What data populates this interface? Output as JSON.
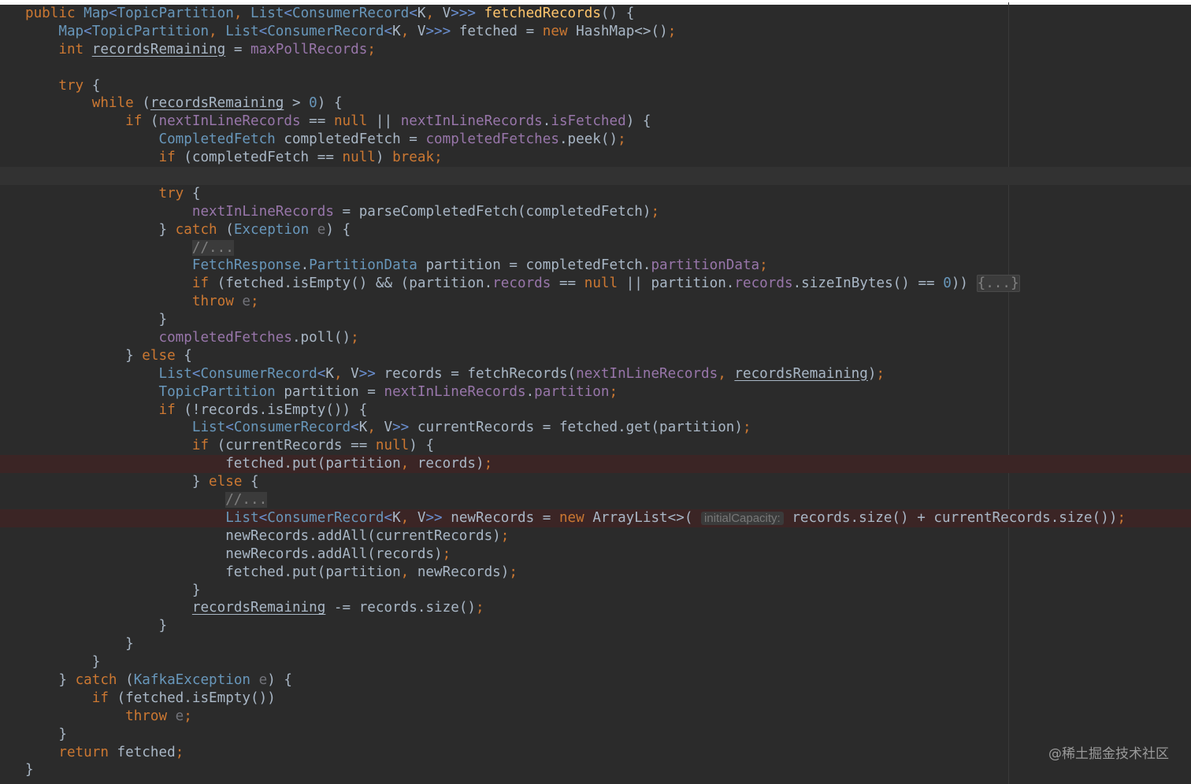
{
  "watermark": "@稀土掘金技术社区",
  "colors": {
    "background": "#2b2b2b",
    "keyword": "#cc7832",
    "field": "#9876aa",
    "method": "#ffc66d",
    "number": "#6897bb",
    "comment": "#808080",
    "text": "#a9b7c6"
  },
  "code_lines": [
    [
      [
        "kw",
        "public "
      ],
      [
        "typ",
        "Map"
      ],
      [
        "tag",
        "<"
      ],
      [
        "typ",
        "TopicPartition"
      ],
      [
        "punc",
        ", "
      ],
      [
        "typ",
        "List"
      ],
      [
        "tag",
        "<"
      ],
      [
        "typ",
        "ConsumerRecord"
      ],
      [
        "tag",
        "<"
      ],
      [
        "var",
        "K"
      ],
      [
        "punc",
        ", "
      ],
      [
        "var",
        "V"
      ],
      [
        "tag",
        ">>> "
      ],
      [
        "meth",
        "fetchedRecords"
      ],
      [
        "var",
        "() {"
      ]
    ],
    [
      [
        "var",
        "    "
      ],
      [
        "typ",
        "Map"
      ],
      [
        "tag",
        "<"
      ],
      [
        "typ",
        "TopicPartition"
      ],
      [
        "punc",
        ", "
      ],
      [
        "typ",
        "List"
      ],
      [
        "tag",
        "<"
      ],
      [
        "typ",
        "ConsumerRecord"
      ],
      [
        "tag",
        "<"
      ],
      [
        "var",
        "K"
      ],
      [
        "punc",
        ", "
      ],
      [
        "var",
        "V"
      ],
      [
        "tag",
        ">>> "
      ],
      [
        "var",
        "fetched = "
      ],
      [
        "kw",
        "new "
      ],
      [
        "var",
        "HashMap<>()"
      ],
      [
        "punc",
        ";"
      ]
    ],
    [
      [
        "var",
        "    "
      ],
      [
        "kw",
        "int "
      ],
      [
        "und",
        "recordsRemaining"
      ],
      [
        "var",
        " = "
      ],
      [
        "fld",
        "maxPollRecords"
      ],
      [
        "punc",
        ";"
      ]
    ],
    [
      [
        "var",
        ""
      ]
    ],
    [
      [
        "var",
        "    "
      ],
      [
        "kw",
        "try "
      ],
      [
        "var",
        "{"
      ]
    ],
    [
      [
        "var",
        "        "
      ],
      [
        "kw",
        "while "
      ],
      [
        "var",
        "("
      ],
      [
        "und",
        "recordsRemaining"
      ],
      [
        "var",
        " > "
      ],
      [
        "num",
        "0"
      ],
      [
        "var",
        ") {"
      ]
    ],
    [
      [
        "var",
        "            "
      ],
      [
        "kw",
        "if "
      ],
      [
        "var",
        "("
      ],
      [
        "fld",
        "nextInLineRecords"
      ],
      [
        "var",
        " == "
      ],
      [
        "kw",
        "null"
      ],
      [
        "var",
        " || "
      ],
      [
        "fld",
        "nextInLineRecords"
      ],
      [
        "var",
        "."
      ],
      [
        "fld",
        "isFetched"
      ],
      [
        "var",
        ") {"
      ]
    ],
    [
      [
        "var",
        "                "
      ],
      [
        "typ",
        "CompletedFetch "
      ],
      [
        "var",
        "completedFetch = "
      ],
      [
        "fld",
        "completedFetches"
      ],
      [
        "var",
        ".peek()"
      ],
      [
        "punc",
        ";"
      ]
    ],
    [
      [
        "var",
        "                "
      ],
      [
        "kw",
        "if "
      ],
      [
        "var",
        "(completedFetch == "
      ],
      [
        "kw",
        "null"
      ],
      [
        "var",
        ") "
      ],
      [
        "kw",
        "break"
      ],
      [
        "punc",
        ";"
      ]
    ],
    [
      [
        "var",
        ""
      ]
    ],
    [
      [
        "var",
        "                "
      ],
      [
        "kw",
        "try "
      ],
      [
        "var",
        "{"
      ]
    ],
    [
      [
        "var",
        "                    "
      ],
      [
        "fld",
        "nextInLineRecords"
      ],
      [
        "var",
        " = parseCompletedFetch(completedFetch)"
      ],
      [
        "punc",
        ";"
      ]
    ],
    [
      [
        "var",
        "                } "
      ],
      [
        "kw",
        "catch "
      ],
      [
        "var",
        "("
      ],
      [
        "typ",
        "Exception "
      ],
      [
        "param",
        "e"
      ],
      [
        "var",
        ") {"
      ]
    ],
    [
      [
        "var",
        "                    "
      ],
      [
        "cmt",
        "//..."
      ]
    ],
    [
      [
        "var",
        "                    "
      ],
      [
        "typ",
        "FetchResponse"
      ],
      [
        "var",
        "."
      ],
      [
        "typ",
        "PartitionData "
      ],
      [
        "var",
        "partition = completedFetch."
      ],
      [
        "fld",
        "partitionData"
      ],
      [
        "punc",
        ";"
      ]
    ],
    [
      [
        "var",
        "                    "
      ],
      [
        "kw",
        "if "
      ],
      [
        "var",
        "(fetched.isEmpty() && (partition."
      ],
      [
        "fld",
        "records"
      ],
      [
        "var",
        " == "
      ],
      [
        "kw",
        "null"
      ],
      [
        "var",
        " || partition."
      ],
      [
        "fld",
        "records"
      ],
      [
        "var",
        ".sizeInBytes() == "
      ],
      [
        "num",
        "0"
      ],
      [
        "var",
        ")) "
      ],
      [
        "fold",
        "{...}"
      ]
    ],
    [
      [
        "var",
        "                    "
      ],
      [
        "kw",
        "throw "
      ],
      [
        "param",
        "e"
      ],
      [
        "punc",
        ";"
      ]
    ],
    [
      [
        "var",
        "                }"
      ]
    ],
    [
      [
        "var",
        "                "
      ],
      [
        "fld",
        "completedFetches"
      ],
      [
        "var",
        ".poll()"
      ],
      [
        "punc",
        ";"
      ]
    ],
    [
      [
        "var",
        "            } "
      ],
      [
        "kw",
        "else "
      ],
      [
        "var",
        "{"
      ]
    ],
    [
      [
        "var",
        "                "
      ],
      [
        "typ",
        "List"
      ],
      [
        "tag",
        "<"
      ],
      [
        "typ",
        "ConsumerRecord"
      ],
      [
        "tag",
        "<"
      ],
      [
        "var",
        "K"
      ],
      [
        "punc",
        ", "
      ],
      [
        "var",
        "V"
      ],
      [
        "tag",
        ">> "
      ],
      [
        "var",
        "records = fetchRecords("
      ],
      [
        "fld",
        "nextInLineRecords"
      ],
      [
        "punc",
        ", "
      ],
      [
        "und",
        "recordsRemaining"
      ],
      [
        "var",
        ")"
      ],
      [
        "punc",
        ";"
      ]
    ],
    [
      [
        "var",
        "                "
      ],
      [
        "typ",
        "TopicPartition "
      ],
      [
        "var",
        "partition = "
      ],
      [
        "fld",
        "nextInLineRecords"
      ],
      [
        "var",
        "."
      ],
      [
        "fld",
        "partition"
      ],
      [
        "punc",
        ";"
      ]
    ],
    [
      [
        "var",
        "                "
      ],
      [
        "kw",
        "if "
      ],
      [
        "var",
        "(!records.isEmpty()) {"
      ]
    ],
    [
      [
        "var",
        "                    "
      ],
      [
        "typ",
        "List"
      ],
      [
        "tag",
        "<"
      ],
      [
        "typ",
        "ConsumerRecord"
      ],
      [
        "tag",
        "<"
      ],
      [
        "var",
        "K"
      ],
      [
        "punc",
        ", "
      ],
      [
        "var",
        "V"
      ],
      [
        "tag",
        ">> "
      ],
      [
        "var",
        "currentRecords = fetched.get(partition)"
      ],
      [
        "punc",
        ";"
      ]
    ],
    [
      [
        "var",
        "                    "
      ],
      [
        "kw",
        "if "
      ],
      [
        "var",
        "(currentRecords == "
      ],
      [
        "kw",
        "null"
      ],
      [
        "var",
        ") {"
      ]
    ],
    [
      [
        "var",
        "                        fetched.put(partition"
      ],
      [
        "punc",
        ", "
      ],
      [
        "var",
        "records)"
      ],
      [
        "punc",
        ";"
      ]
    ],
    [
      [
        "var",
        "                    } "
      ],
      [
        "kw",
        "else "
      ],
      [
        "var",
        "{"
      ]
    ],
    [
      [
        "var",
        "                        "
      ],
      [
        "cmt",
        "//..."
      ]
    ],
    [
      [
        "var",
        "                        "
      ],
      [
        "typ",
        "List"
      ],
      [
        "tag",
        "<"
      ],
      [
        "typ",
        "ConsumerRecord"
      ],
      [
        "tag",
        "<"
      ],
      [
        "var",
        "K"
      ],
      [
        "punc",
        ", "
      ],
      [
        "var",
        "V"
      ],
      [
        "tag",
        ">> "
      ],
      [
        "var",
        "newRecords = "
      ],
      [
        "kw",
        "new "
      ],
      [
        "var",
        "ArrayList<>( "
      ],
      [
        "hint",
        "initialCapacity:"
      ],
      [
        "var",
        " records.size() + currentRecords.size())"
      ],
      [
        "punc",
        ";"
      ]
    ],
    [
      [
        "var",
        "                        newRecords.addAll(currentRecords)"
      ],
      [
        "punc",
        ";"
      ]
    ],
    [
      [
        "var",
        "                        newRecords.addAll(records)"
      ],
      [
        "punc",
        ";"
      ]
    ],
    [
      [
        "var",
        "                        fetched.put(partition"
      ],
      [
        "punc",
        ", "
      ],
      [
        "var",
        "newRecords)"
      ],
      [
        "punc",
        ";"
      ]
    ],
    [
      [
        "var",
        "                    }"
      ]
    ],
    [
      [
        "var",
        "                    "
      ],
      [
        "und",
        "recordsRemaining"
      ],
      [
        "var",
        " -= records.size()"
      ],
      [
        "punc",
        ";"
      ]
    ],
    [
      [
        "var",
        "                }"
      ]
    ],
    [
      [
        "var",
        "            }"
      ]
    ],
    [
      [
        "var",
        "        }"
      ]
    ],
    [
      [
        "var",
        "    } "
      ],
      [
        "kw",
        "catch "
      ],
      [
        "var",
        "("
      ],
      [
        "typ",
        "KafkaException "
      ],
      [
        "param",
        "e"
      ],
      [
        "var",
        ") {"
      ]
    ],
    [
      [
        "var",
        "        "
      ],
      [
        "kw",
        "if "
      ],
      [
        "var",
        "(fetched.isEmpty())"
      ]
    ],
    [
      [
        "var",
        "            "
      ],
      [
        "kw",
        "throw "
      ],
      [
        "param",
        "e"
      ],
      [
        "punc",
        ";"
      ]
    ],
    [
      [
        "var",
        "    }"
      ]
    ],
    [
      [
        "var",
        "    "
      ],
      [
        "kw",
        "return "
      ],
      [
        "var",
        "fetched"
      ],
      [
        "punc",
        ";"
      ]
    ],
    [
      [
        "var",
        "}"
      ]
    ]
  ],
  "line_states": {
    "9": "current",
    "25": "bp",
    "28": "bp"
  }
}
